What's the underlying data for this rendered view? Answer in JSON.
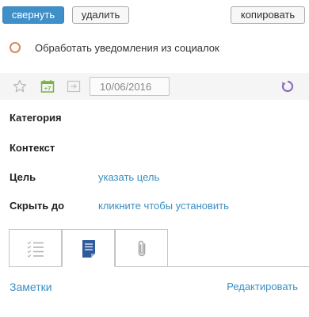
{
  "toolbar": {
    "collapse_label": "свернуть",
    "delete_label": "удалить",
    "copy_label": "копировать"
  },
  "task": {
    "title": "Обработать уведомления из социалок",
    "status_color": "#d8885c"
  },
  "meta": {
    "date_value": "10/06/2016",
    "calendar_badge": "+7",
    "icons": [
      "star-icon",
      "calendar-icon",
      "defer-icon",
      "refresh-icon"
    ]
  },
  "properties": {
    "category_label": "Категория",
    "context_label": "Контекст",
    "goal_label": "Цель",
    "goal_value": "указать цель",
    "hide_label": "Скрыть до",
    "hide_value": "кликните чтобы установить"
  },
  "tabs": {
    "icons": [
      "checklist-icon",
      "notes-icon",
      "paperclip-icon"
    ],
    "active": "notes-icon"
  },
  "notes": {
    "title": "Заметки",
    "edit_label": "Редактировать"
  },
  "colors": {
    "primary": "#3f8fc9",
    "link": "#3a8fc2",
    "calendar_green": "#7bb241",
    "refresh_purple": "#8d6bc1"
  }
}
